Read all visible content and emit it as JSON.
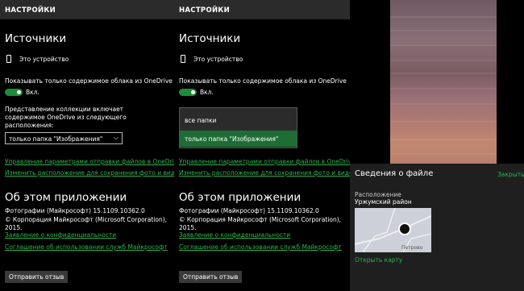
{
  "left": {
    "header": "НАСТРОЙКИ",
    "sources_title": "Источники",
    "this_device": "Это устройство",
    "onedrive_only": "Показывать только содержимое облака из OneDrive",
    "toggle_state": "Вкл.",
    "collection_line1": "Представление коллекции включает",
    "collection_line2": "содержимое OneDrive из следующего",
    "collection_line3": "расположения:",
    "folder_select": "только папка \"Изображения\"",
    "link_manage": "Управление параметрами отправки файлов в OneDrive",
    "link_change": "Изменить расположение для сохранения фото и видео",
    "about_title": "Об этом приложении",
    "app_version": "Фотографии (Майкрософт) 15.1109.10362.0",
    "copyright": "© Корпорация Майкрософт (Microsoft Corporation), 2015.",
    "privacy": "Заявление о конфиденциальности",
    "terms": "Соглашение об использовании служб Майкрософт",
    "feedback_button": "Отправить отзыв"
  },
  "middle": {
    "header": "НАСТРОЙКИ",
    "sources_title": "Источники",
    "this_device": "Это устройство",
    "onedrive_only": "Показывать только содержимое облака из OneDrive",
    "toggle_state": "Вкл.",
    "dropdown_options": [
      "все папки",
      "только папка \"Изображения\""
    ],
    "link_manage": "Управление параметрами отправки файлов в OneDrive",
    "link_change": "Изменить расположение для сохранения фото и видео",
    "about_title": "Об этом приложении",
    "app_version": "Фотографии (Майкрософт) 15.1109.10362.0",
    "copyright": "© Корпорация Майкрософт (Microsoft Corporation), 2015.",
    "privacy": "Заявление о конфиденциальности",
    "terms": "Соглашение об использовании служб Майкрософт",
    "feedback_button": "Отправить отзыв"
  },
  "right": {
    "file_info_title": "Сведения о файле",
    "close_link": "Закрыть",
    "location_label": "Расположение",
    "location_value": "Уржумский район",
    "map_place": "Петрово",
    "open_map": "Открыть карту"
  },
  "colors": {
    "accent": "#2fb24f",
    "toggle": "#1e8c3a",
    "selected": "#1e6d34"
  },
  "icons": [
    "phone-icon",
    "chevron-down-icon",
    "map-pin-icon"
  ]
}
